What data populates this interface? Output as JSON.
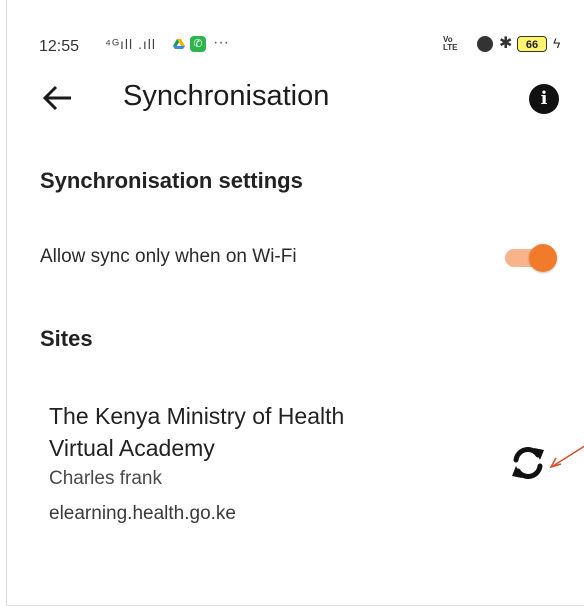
{
  "statusbar": {
    "time": "12:55",
    "signal": "⁴ᴳıll .ıll",
    "dots": "···",
    "volte": "Vo\nLTE",
    "battery": "66"
  },
  "header": {
    "title": "Synchronisation"
  },
  "settings": {
    "heading": "Synchronisation settings",
    "wifi_only_label": "Allow sync only when on Wi-Fi",
    "wifi_only_enabled": true
  },
  "sites": {
    "heading": "Sites",
    "items": [
      {
        "name": "The Kenya Ministry of Health Virtual Academy",
        "user": "Charles frank",
        "url": "elearning.health.go.ke"
      }
    ]
  },
  "colors": {
    "accent": "#f27a2b",
    "accent_track": "#f7b38a",
    "annotation": "#d2502a"
  },
  "icons": {
    "back": "arrow-left-icon",
    "info": "info-icon",
    "sync": "sync-icon"
  }
}
